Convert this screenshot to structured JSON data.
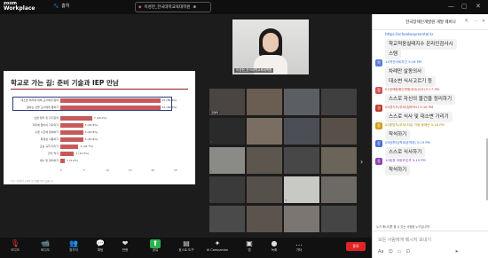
{
  "titlebar": {
    "logo_line1": "zoom",
    "logo_line2": "Workplace",
    "home_label": "홈히",
    "meeting_tab": "이성현_한국대학교육대학원"
  },
  "slide": {
    "title": "학교로 가는 길: 준비 기술과 IEP 만남",
    "footer": "자료: 국립특수교육원 학교생활 준비 실태조사",
    "bars": [
      {
        "label": "대소변 처리에 대해 교사에게 알려",
        "value": 22,
        "text": "22 (86.4%)"
      },
      {
        "label": "원하는 것을 교사에게 말하기",
        "value": 22,
        "text": "22 (86.4%)"
      },
      {
        "label": "신변 정리 및 자기관리",
        "value": 7,
        "text": "7 (29.2%)"
      },
      {
        "label": "자리에 앉아서 기다리기",
        "value": 5,
        "text": "5 (20.8%)"
      },
      {
        "label": "수업 시간에 참여하기",
        "value": 5,
        "text": "5 (20.8%)"
      },
      {
        "label": "화장실 사용하기",
        "value": 5,
        "text": "5 (20.8%)"
      },
      {
        "label": "교실 규칙 지키기",
        "value": 4,
        "text": "4 (16.7%)"
      },
      {
        "label": "급식 먹기",
        "value": 3,
        "text": "3 (12.5%)"
      },
      {
        "label": "세수 및 양치하기",
        "value": 1,
        "text": "1 (4.2%)"
      }
    ],
    "axis_ticks": [
      "0",
      "5",
      "10",
      "15",
      "20",
      "25"
    ]
  },
  "speaker": {
    "name": "이성현_한국대학교육대학원"
  },
  "gallery": {
    "tiles": [
      {
        "name": "권영미",
        "color": "#4a4542"
      },
      {
        "name": "",
        "color": "#6a5d52"
      },
      {
        "name": "",
        "color": "#5b5e63"
      },
      {
        "name": "",
        "color": "#3f3f3f"
      },
      {
        "name": "",
        "color": "#2a2a2a"
      },
      {
        "name": "",
        "color": "#7a6e62"
      },
      {
        "name": "",
        "color": "#4b4f55"
      },
      {
        "name": "",
        "color": "#585048"
      },
      {
        "name": "",
        "color": "#8a8a86"
      },
      {
        "name": "",
        "color": "#5c564f"
      },
      {
        "name": "",
        "color": "#474747"
      },
      {
        "name": "",
        "color": "#6b6458"
      },
      {
        "name": "",
        "color": "#3a3a3a"
      },
      {
        "name": "",
        "color": "#55504a"
      },
      {
        "name": "",
        "color": "#c8c8c4"
      },
      {
        "name": "",
        "color": "#6d6a66"
      },
      {
        "name": "",
        "color": "#4a4a4a"
      },
      {
        "name": "",
        "color": "#5a544d"
      },
      {
        "name": "",
        "color": "#7c7672"
      },
      {
        "name": "",
        "color": "#454545"
      }
    ]
  },
  "chat": {
    "title": "한국장애인개발원 개발 웨비나",
    "messages": [
      {
        "kind": "link",
        "text": "https://schoolwaymental.kr"
      },
      {
        "kind": "bubble",
        "text": "학교적응실태지수 온라인검사시"
      },
      {
        "kind": "bubble_cont",
        "text": "스템"
      },
      {
        "kind": "sender",
        "text": "14약진아비자긴  5:16 PM",
        "color": "#2d6bd8",
        "avatar": "약",
        "avatar_color": "#5a7bd8"
      },
      {
        "kind": "bubble",
        "text": "차례만 살동의사"
      },
      {
        "kind": "bubble_cont",
        "text": "대소변 식사고르기 등"
      },
      {
        "kind": "sender",
        "text": "01장애등록인연림대사(교사)  5:17 PM",
        "color": "#c0392b",
        "avatar": "장",
        "avatar_color": "#d35454"
      },
      {
        "kind": "bubble",
        "text": "스스로 자신의 물건을 정리하기"
      },
      {
        "kind": "sender",
        "text": "05경기도(부모)정보모니  5:18 PM",
        "color": "#c0392b",
        "avatar": "경",
        "avatar_color": "#c0392b"
      },
      {
        "kind": "bubble",
        "text": "스스로 식사 및 대소변 가리기"
      },
      {
        "kind": "sender",
        "text": "02중앙도(부모)자유 가정 동에던 5:18 PM",
        "color": "#b38600",
        "avatar": "중",
        "avatar_color": "#d4a017"
      },
      {
        "kind": "bubble",
        "text": "착석하기"
      },
      {
        "kind": "sender",
        "text": "09장후티(학대상역대)  5:19 PM",
        "color": "#2d6bd8",
        "avatar": "장",
        "avatar_color": "#4a6fd1"
      },
      {
        "kind": "bubble",
        "text": "스스로 식사하기"
      },
      {
        "kind": "sender",
        "text": "10동경 아동보호자  5:19 PM",
        "color": "#7d3cc8",
        "avatar": "동",
        "avatar_color": "#8e44ad"
      },
      {
        "kind": "bubble",
        "text": "착석하기"
      }
    ],
    "notice": "누가 메시지를 볼 수 있는 사람을 누구입니까?",
    "input_placeholder": "모든 사람에게 메시지 보내기"
  },
  "toolbar": {
    "items": [
      {
        "icon": "🎙",
        "label": "오디오",
        "name": "audio"
      },
      {
        "icon": "📹",
        "label": "비디오",
        "name": "video"
      },
      {
        "icon": "👥",
        "label": "참가자",
        "name": "participants"
      },
      {
        "icon": "💬",
        "label": "채팅",
        "name": "chat"
      },
      {
        "icon": "❤",
        "label": "반응",
        "name": "react"
      },
      {
        "icon": "⬆",
        "label": "공유",
        "name": "share"
      },
      {
        "icon": "▤",
        "label": "호스트 도구",
        "name": "host-tools"
      },
      {
        "icon": "✦",
        "label": "AI Companion",
        "name": "ai-companion"
      },
      {
        "icon": "▣",
        "label": "앱",
        "name": "apps"
      },
      {
        "icon": "●",
        "label": "녹화",
        "name": "record"
      },
      {
        "icon": "…",
        "label": "기타",
        "name": "more"
      }
    ],
    "end_label": "종료"
  }
}
